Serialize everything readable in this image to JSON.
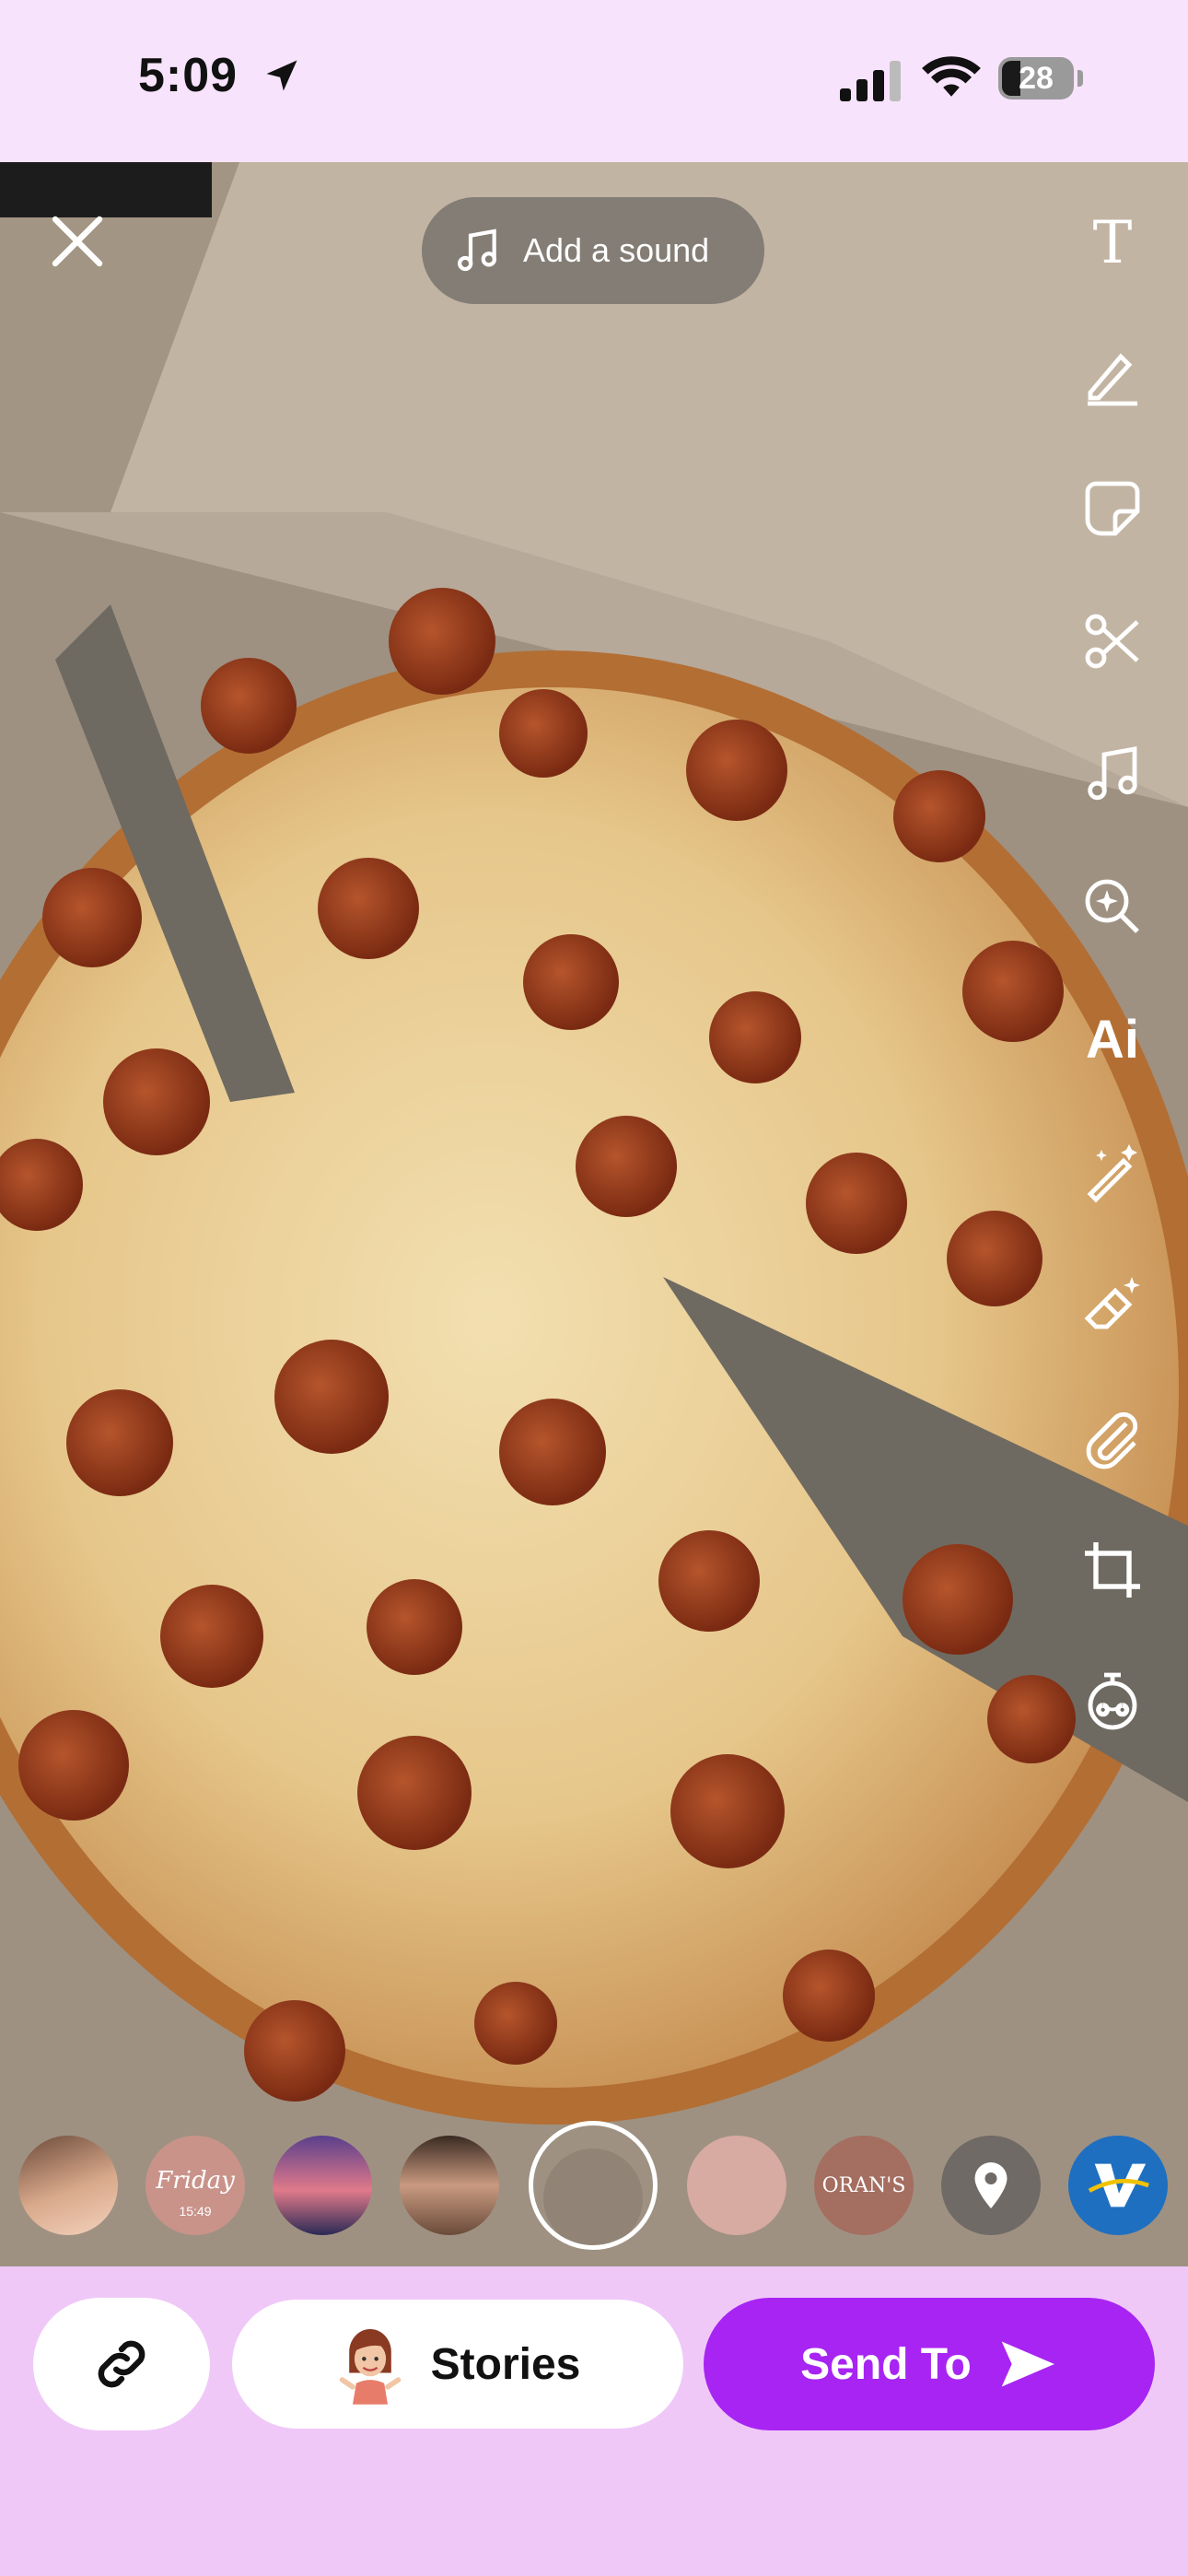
{
  "status_bar": {
    "time": "5:09",
    "battery": "28",
    "icons": [
      "location-arrow-icon",
      "cellular-signal-icon",
      "wifi-icon",
      "battery-icon"
    ]
  },
  "editor": {
    "add_sound_label": "Add a sound",
    "tools": [
      {
        "name": "text-tool",
        "icon": "text-icon",
        "glyph": "T"
      },
      {
        "name": "draw-tool",
        "icon": "pencil-icon"
      },
      {
        "name": "sticker-tool",
        "icon": "sticker-icon"
      },
      {
        "name": "scissors-tool",
        "icon": "scissors-icon"
      },
      {
        "name": "music-tool",
        "icon": "music-note-icon"
      },
      {
        "name": "lens-search-tool",
        "icon": "sparkle-search-icon"
      },
      {
        "name": "ai-tool",
        "icon": "ai-icon",
        "glyph": "Ai"
      },
      {
        "name": "magic-wand-tool",
        "icon": "magic-wand-icon"
      },
      {
        "name": "magic-eraser-tool",
        "icon": "eraser-sparkle-icon"
      },
      {
        "name": "attach-link-tool",
        "icon": "paperclip-icon"
      },
      {
        "name": "crop-tool",
        "icon": "crop-icon"
      },
      {
        "name": "timer-tool",
        "icon": "timer-icon"
      }
    ]
  },
  "story_filters": {
    "items": [
      {
        "name": "filter-face-thumbnail",
        "caption": ""
      },
      {
        "name": "filter-friday",
        "caption": "Friday",
        "small": "15:49"
      },
      {
        "name": "filter-sunset",
        "caption": ""
      },
      {
        "name": "filter-portrait",
        "caption": ""
      },
      {
        "name": "filter-none-selected",
        "caption": ""
      },
      {
        "name": "filter-pink",
        "caption": ""
      },
      {
        "name": "filter-orans",
        "caption": "ORAN'S"
      },
      {
        "name": "filter-location",
        "caption": ""
      },
      {
        "name": "filter-venmo",
        "caption": ""
      }
    ]
  },
  "bottom_bar": {
    "stories_label": "Stories",
    "send_label": "Send To"
  },
  "colors": {
    "accent": "#a724f2",
    "bottom_bar_bg": "#efc8f8",
    "status_bar_bg": "#f8e3fc"
  }
}
